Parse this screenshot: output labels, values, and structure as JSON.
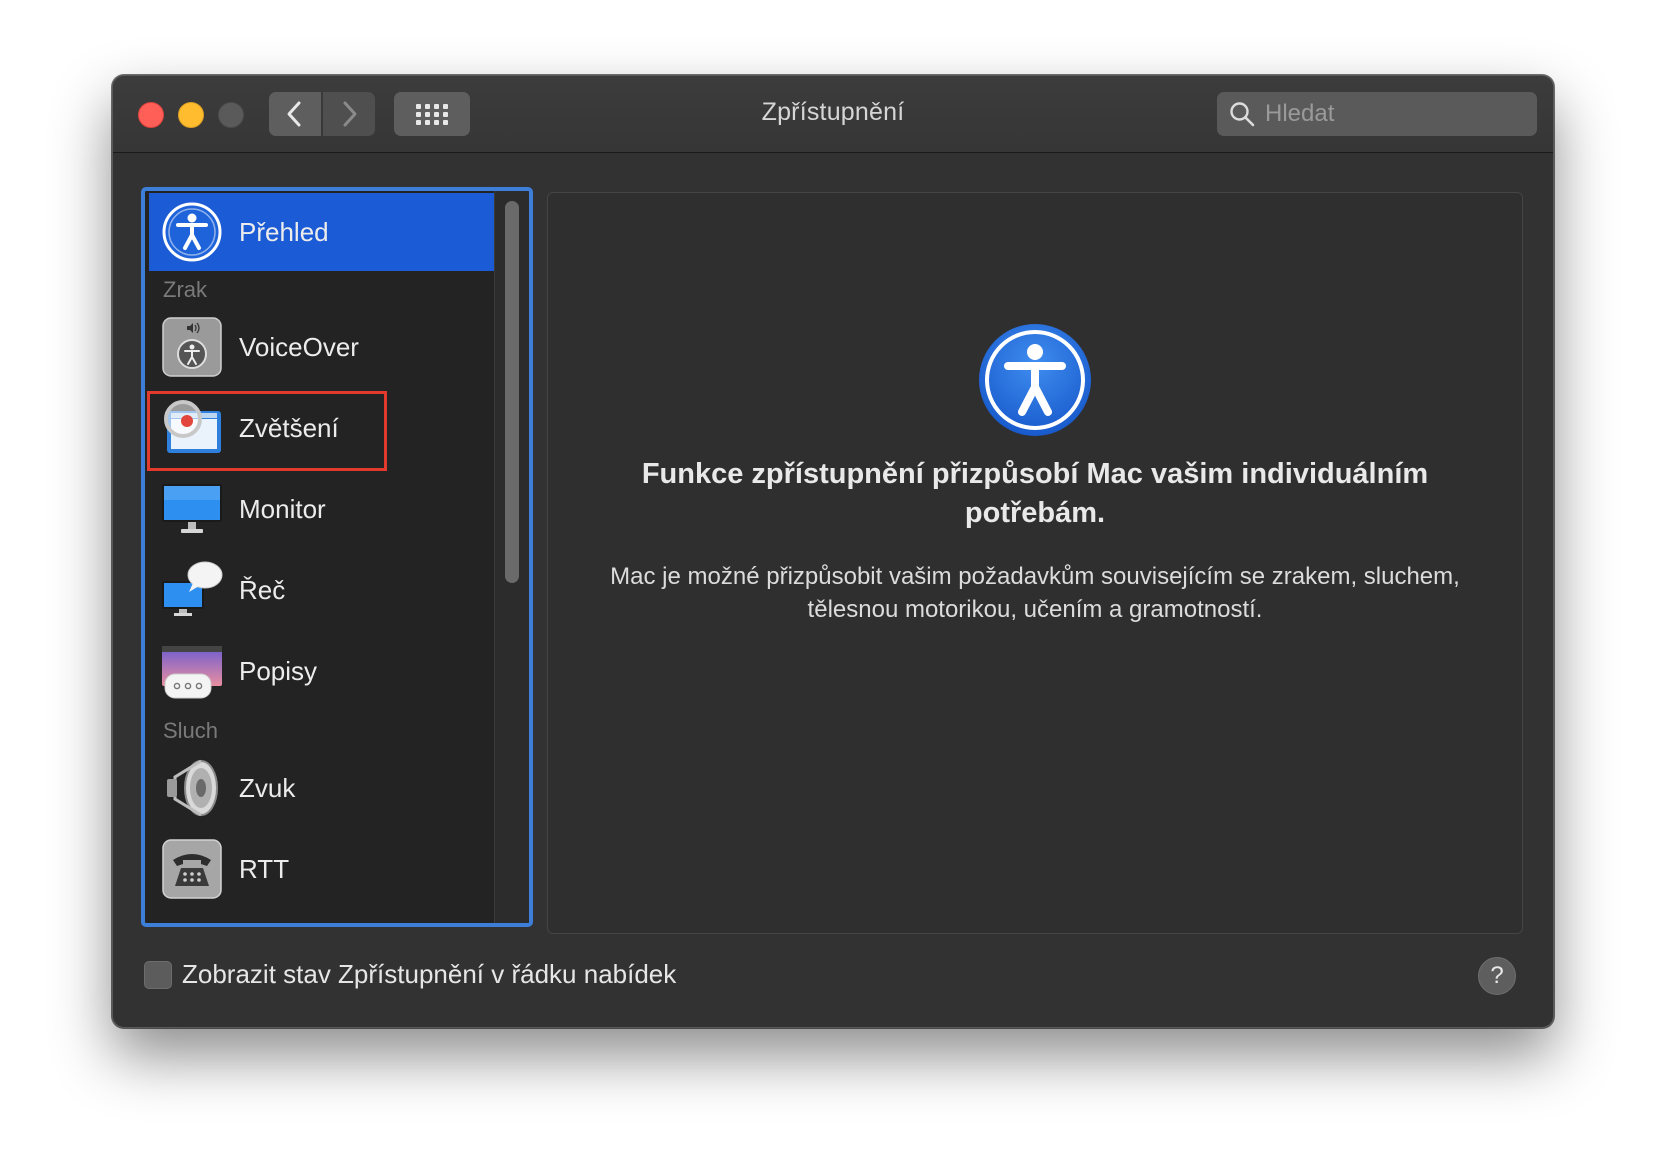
{
  "window": {
    "title": "Zpřístupnění",
    "search_placeholder": "Hledat"
  },
  "sidebar": {
    "items": [
      {
        "label": "Přehled",
        "icon": "accessibility-icon",
        "selected": true
      },
      {
        "label": "VoiceOver",
        "icon": "voiceover-icon"
      },
      {
        "label": "Zvětšení",
        "icon": "zoom-icon",
        "highlighted": true
      },
      {
        "label": "Monitor",
        "icon": "monitor-icon"
      },
      {
        "label": "Řeč",
        "icon": "speech-icon"
      },
      {
        "label": "Popisy",
        "icon": "captions-icon"
      },
      {
        "label": "Zvuk",
        "icon": "speaker-icon"
      },
      {
        "label": "RTT",
        "icon": "telephone-icon"
      }
    ],
    "sections": {
      "vision": "Zrak",
      "hearing": "Sluch"
    }
  },
  "main": {
    "headline": "Funkce zpřístupnění přizpůsobí Mac vašim individuálním potřebám.",
    "description": "Mac je možné přizpůsobit vašim požadavkům souvisejícím se zrakem, sluchem, tělesnou motorikou, učením a gramotností."
  },
  "footer": {
    "checkbox_label": "Zobrazit stav Zpřístupnění v řádku nabídek",
    "checkbox_checked": false,
    "help": "?"
  },
  "colors": {
    "selection": "#1b5bd6",
    "focus_ring": "#3d7ed9",
    "annotation": "#e23a2c",
    "close": "#ff5f57",
    "minimize": "#febc2e"
  }
}
